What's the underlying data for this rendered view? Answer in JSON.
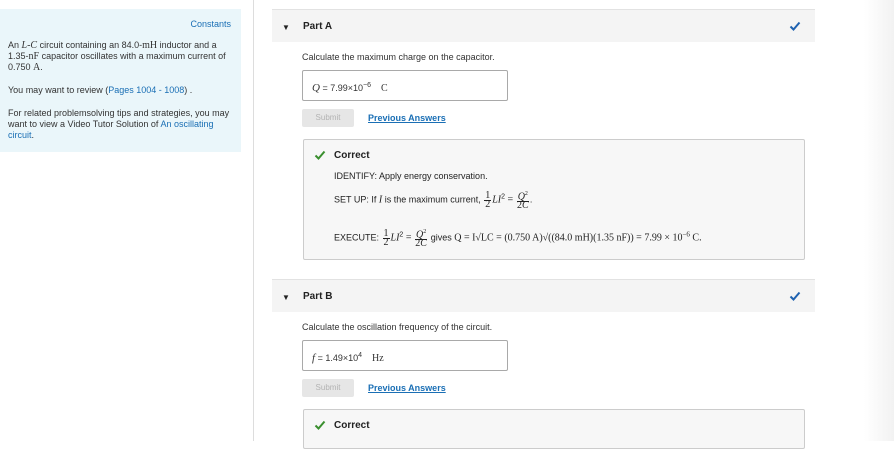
{
  "sidebar": {
    "constants_label": "Constants",
    "problem": {
      "t1": "An ",
      "m1": "L-C",
      "t2": " circuit containing an 84.0-",
      "m2": "mH",
      "t3": " inductor and a 1.35-",
      "m3": "nF",
      "t4": " capacitor oscillates with a maximum current of 0.750 ",
      "m4": "A",
      "t5": "."
    },
    "review_prefix": "You may want to review (",
    "review_link": "Pages 1004 - 1008",
    "review_suffix": ") .",
    "tips_text": "For related problemsolving tips and strategies, you may want to view a Video Tutor Solution of ",
    "tips_link": "An oscillating circuit",
    "tips_suffix": "."
  },
  "partA": {
    "title": "Part A",
    "prompt": "Calculate the maximum charge on the capacitor.",
    "var": "Q",
    "eq": " = ",
    "mantissa": "7.99×10",
    "exponent": "−6",
    "unit": "C",
    "submit_label": "Submit",
    "prev_label": "Previous Answers",
    "feedback": {
      "title": "Correct",
      "identify": "IDENTIFY: Apply energy conservation.",
      "setup_prefix": "SET UP: If ",
      "setup_var": "I",
      "setup_mid": " is the maximum current, ",
      "execute_prefix": "EXECUTE: ",
      "execute_gives": " gives ",
      "execute_expr": "Q = I√LC = (0.750 A)√((84.0 mH)(1.35 nF)) = 7.99 × 10",
      "execute_exp": "−6",
      "execute_unit": " C."
    }
  },
  "partB": {
    "title": "Part B",
    "prompt": "Calculate the oscillation frequency of the circuit.",
    "var": "f",
    "eq": " = ",
    "mantissa": "1.49×10",
    "exponent": "4",
    "unit": "Hz",
    "submit_label": "Submit",
    "prev_label": "Previous Answers",
    "feedback_title": "Correct"
  },
  "colors": {
    "accent_link": "#1a6fb5",
    "check_green": "#3a8f2f",
    "check_blue": "#1f62b0",
    "sidebar_bg": "#eaf6fa"
  }
}
